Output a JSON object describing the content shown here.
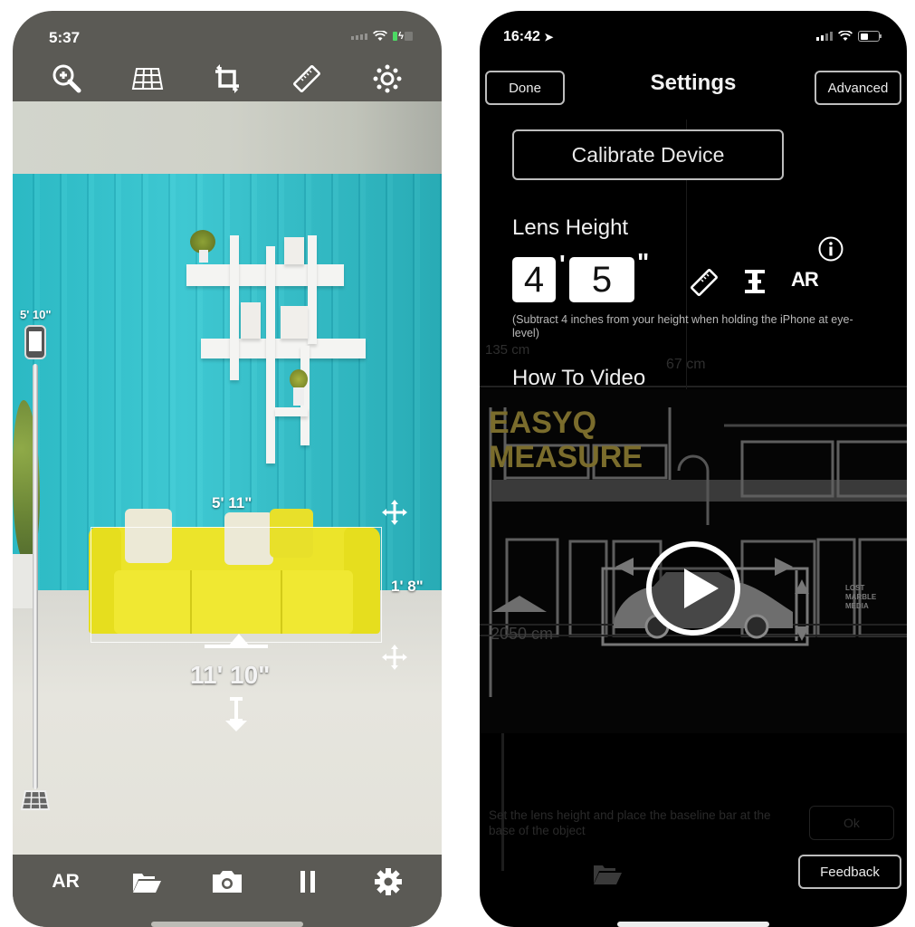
{
  "left_phone": {
    "status_bar": {
      "time": "5:37",
      "icons": [
        "wifi-icon",
        "battery-charging-icon"
      ]
    },
    "toolbar": [
      {
        "name": "zoom-in-icon"
      },
      {
        "name": "grid-icon"
      },
      {
        "name": "crop-rotate-icon"
      },
      {
        "name": "ruler-icon"
      },
      {
        "name": "brightness-icon"
      }
    ],
    "measurements": {
      "lens_height_label": "5' 10\"",
      "width_label": "5' 11\"",
      "height_label": "1' 8\"",
      "distance_label": "11' 10\""
    },
    "bottom_bar": {
      "ar_label": "AR",
      "icons": [
        "ar-button",
        "folder-icon",
        "camera-icon",
        "pause-icon",
        "settings-gear-icon"
      ]
    }
  },
  "right_phone": {
    "status_bar": {
      "time": "16:42",
      "icons": [
        "location-arrow-icon",
        "signal-icon",
        "wifi-icon",
        "battery-icon"
      ]
    },
    "nav": {
      "done_label": "Done",
      "title": "Settings",
      "advanced_label": "Advanced"
    },
    "calibrate_label": "Calibrate Device",
    "lens_height": {
      "label": "Lens Height",
      "feet": "4",
      "inches": "5",
      "feet_mark": "'",
      "inches_mark": "\"",
      "ar_label": "AR",
      "hint": "(Subtract 4 inches from your height when holding the iPhone at eye-level)"
    },
    "how_to_video_label": "How To Video",
    "video": {
      "brand_line1": "EASYQ",
      "brand_line2": "MEASURE",
      "overlay_distance": "2050 cm",
      "overlay_width": "67 cm",
      "overlay_height": "135 cm",
      "watermark": "LOST MARBLE MEDIA"
    },
    "background_hint": "Set the lens height and place the baseline bar at the base of the object",
    "background_ok": "Ok",
    "feedback_label": "Feedback"
  }
}
